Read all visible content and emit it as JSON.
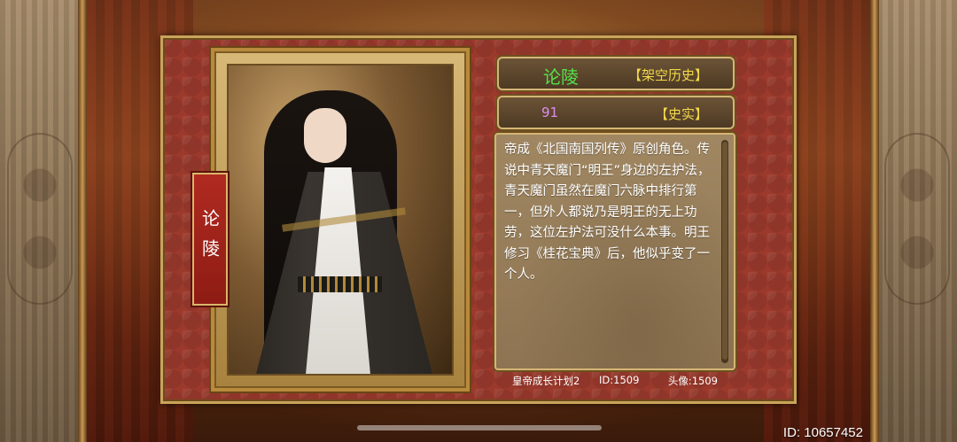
{
  "character": {
    "name": "论陵",
    "name_vertical": "论陵",
    "category_tag": "【架空历史】",
    "number": "91",
    "history_tag": "【史实】",
    "description": "帝成《北国南国列传》原创角色。传说中青天魔门“明王”身边的左护法，青天魔门虽然在魔门六脉中排行第一，但外人都说乃是明王的无上功劳，这位左护法可没什么本事。明王修习《桂花宝典》后，他似乎变了一个人。"
  },
  "footer": {
    "game": "皇帝成长计划2",
    "id": "ID:1509",
    "avatar": "头像:1509"
  },
  "user": {
    "id_label": "ID: 10657452"
  },
  "colors": {
    "name_green": "#54e24a",
    "tag_yellow": "#f2d84a",
    "number_purple": "#e08cf0",
    "panel_red": "#9b3a2c",
    "frame_gold": "#c9a45a"
  }
}
